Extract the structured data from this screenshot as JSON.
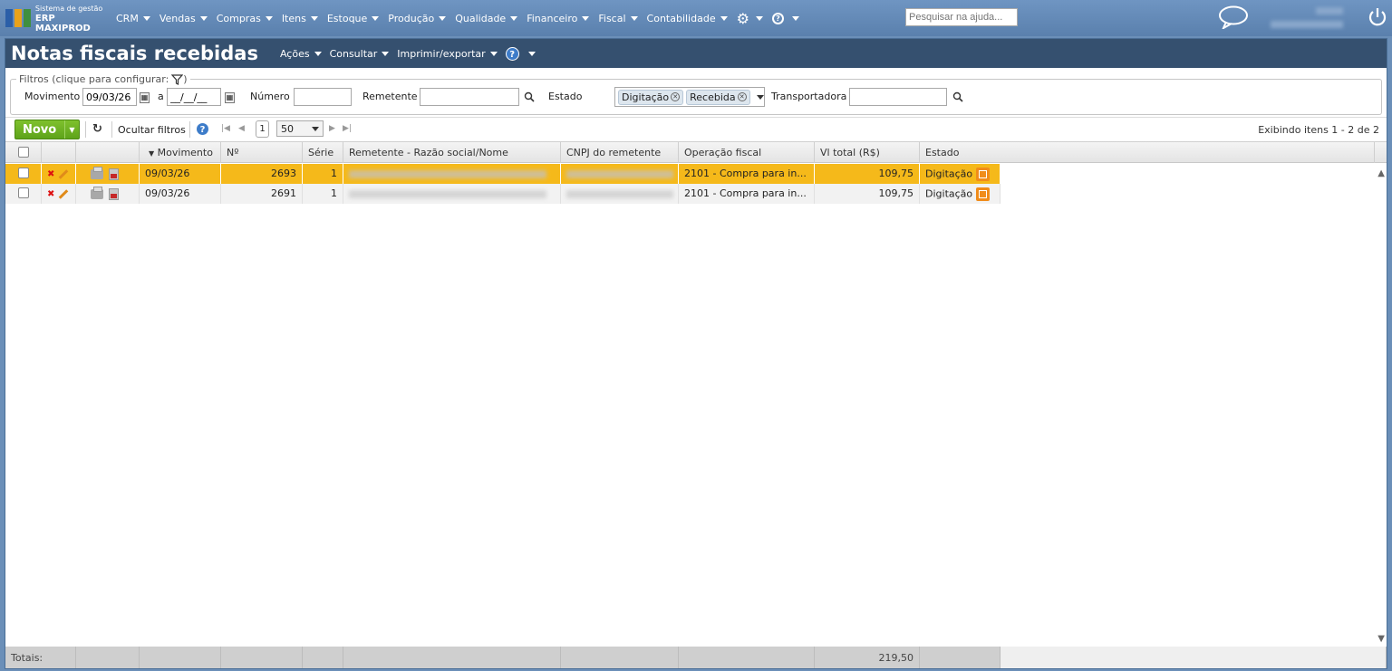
{
  "app": {
    "logo_line1": "Sistema de gestão",
    "logo_line2": "ERP MAXIPROD",
    "menu": [
      "CRM",
      "Vendas",
      "Compras",
      "Itens",
      "Estoque",
      "Produção",
      "Qualidade",
      "Financeiro",
      "Fiscal",
      "Contabilidade"
    ],
    "help_search_placeholder": "Pesquisar na ajuda..."
  },
  "page": {
    "title": "Notas fiscais recebidas",
    "title_menu": [
      "Ações",
      "Consultar",
      "Imprimir/exportar"
    ],
    "help": "?"
  },
  "filters": {
    "legend": "Filtros (clique para configurar:",
    "legend_end": ")",
    "movimento_label": "Movimento",
    "movimento_from": "09/03/26",
    "movimento_sep": "a",
    "movimento_to": "__/__/__",
    "numero_label": "Número",
    "remetente_label": "Remetente",
    "estado_label": "Estado",
    "estado_tags": [
      "Digitação",
      "Recebida"
    ],
    "transportadora_label": "Transportadora"
  },
  "toolbar": {
    "novo_label": "Novo",
    "ocultar_label": "Ocultar filtros",
    "page_current": "1",
    "page_size": "50",
    "info": "Exibindo itens 1 - 2 de 2"
  },
  "grid": {
    "columns": [
      "Movimento",
      "Nº",
      "Série",
      "Remetente - Razão social/Nome",
      "CNPJ do remetente",
      "Operação fiscal",
      "Vl total (R$)",
      "Estado"
    ],
    "rows": [
      {
        "movimento": "09/03/26",
        "numero": "2693",
        "serie": "1",
        "operacao": "2101 - Compra para in...",
        "total": "109,75",
        "estado": "Digitação"
      },
      {
        "movimento": "09/03/26",
        "numero": "2691",
        "serie": "1",
        "operacao": "2101 - Compra para in...",
        "total": "109,75",
        "estado": "Digitação"
      }
    ],
    "totals_label": "Totais:",
    "totals_value": "219,50"
  }
}
